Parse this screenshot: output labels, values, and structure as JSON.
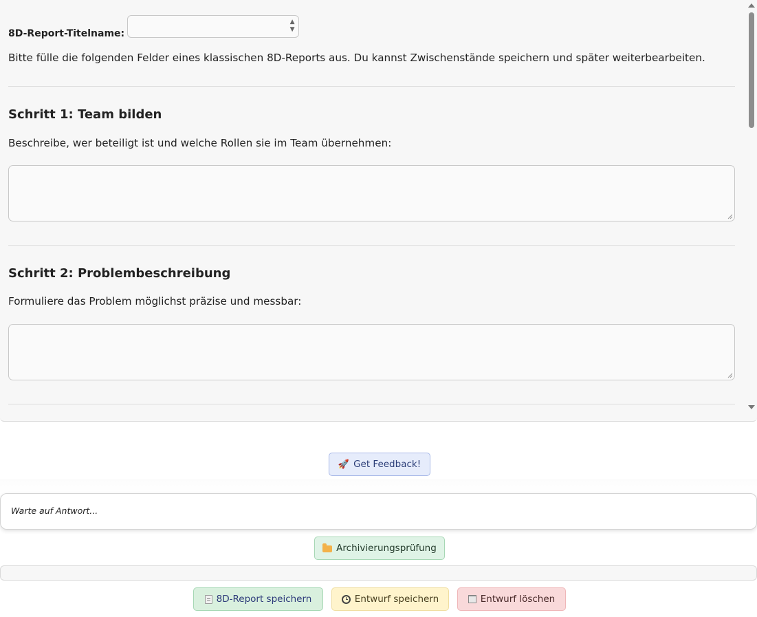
{
  "form": {
    "title_label": "8D-Report-Titelname:",
    "title_value": "",
    "intro": "Bitte fülle die folgenden Felder eines klassischen 8D-Reports aus. Du kannst Zwischenstände speichern und später weiterbearbeiten.",
    "steps": [
      {
        "title": "Schritt 1: Team bilden",
        "description": "Beschreibe, wer beteiligt ist und welche Rollen sie im Team übernehmen:",
        "value": ""
      },
      {
        "title": "Schritt 2: Problembeschreibung",
        "description": "Formuliere das Problem möglichst präzise und messbar:",
        "value": ""
      }
    ]
  },
  "buttons": {
    "feedback_label": "Get Feedback!",
    "archive_label": "Archivierungsprüfung",
    "save_label": "8D-Report speichern",
    "draft_label": "Entwurf speichern",
    "delete_label": "Entwurf löschen"
  },
  "response": {
    "status": "Warte auf Antwort..."
  },
  "icons": {
    "feedback": "rocket-icon",
    "archive": "folder-icon",
    "save": "document-icon",
    "draft": "clock-icon",
    "delete": "trash-icon"
  }
}
